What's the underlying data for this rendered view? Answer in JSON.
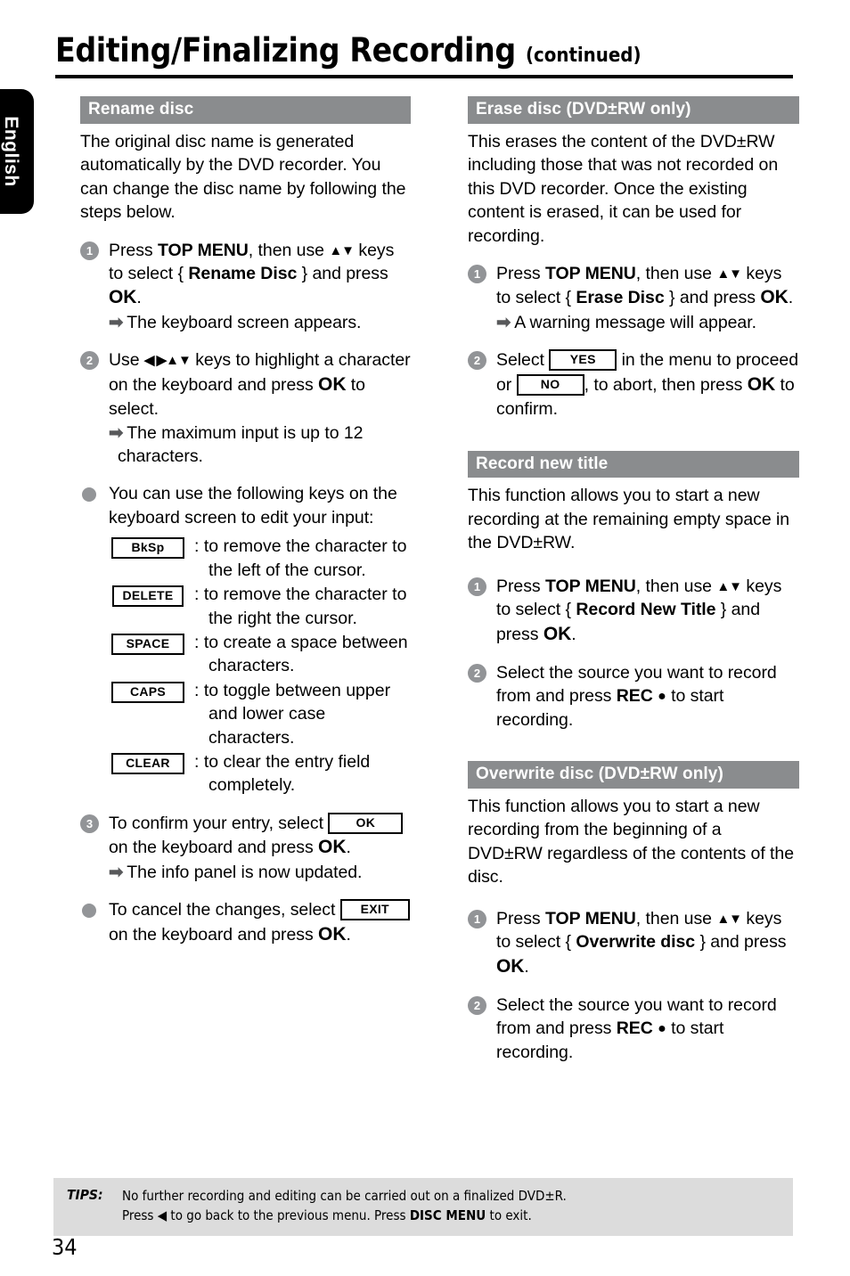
{
  "language_tab": "English",
  "header": {
    "title": "Editing/Finalizing Recording",
    "continued": "(continued)"
  },
  "left_column": {
    "section1": {
      "bar_title": "Rename disc",
      "intro": "The original disc name is generated automatically by the DVD recorder. You can change the disc name by following the steps below.",
      "step1": {
        "num": "1",
        "text_a": "Press ",
        "bold_a": "TOP MENU",
        "text_b": ", then use ",
        "keys": "▲▼",
        "text_c": " keys to select { ",
        "bold_b": "Rename Disc",
        "text_d": " } and press ",
        "bold_c": "OK",
        "text_e": ".",
        "sub": "The keyboard screen appears."
      },
      "step2": {
        "num": "2",
        "text_a": "Use ",
        "keys": "◀ ▶▲▼",
        "text_b": " keys to highlight a character on the keyboard and press ",
        "bold_a": "OK",
        "text_c": " to select.",
        "sub": "The maximum input is up to 12 characters."
      },
      "bullet1": "You can use the following keys on the keyboard screen to edit your input:",
      "keytable": [
        {
          "key": "BkSp",
          "desc": ": to remove the character to the left of the cursor."
        },
        {
          "key": "DELETE",
          "desc": ": to remove the character to the right the cursor."
        },
        {
          "key": "SPACE",
          "desc": ": to create a space between characters."
        },
        {
          "key": "CAPS",
          "desc": ": to toggle between upper and lower case characters."
        },
        {
          "key": "CLEAR",
          "desc": ": to clear the entry field completely."
        }
      ],
      "step3": {
        "num": "3",
        "text_a": "To confirm your entry, select ",
        "keycap": "OK",
        "text_b": " on the keyboard and press ",
        "bold_a": "OK",
        "text_c": ".",
        "sub": "The info panel is now updated."
      },
      "bullet2": {
        "text_a": "To cancel the changes, select ",
        "keycap": "EXIT",
        "text_b": " on the keyboard and press ",
        "bold_a": "OK",
        "text_c": "."
      }
    }
  },
  "right_column": {
    "section_erase": {
      "bar_title": "Erase disc (DVD±RW only)",
      "intro": "This erases the content of the DVD±RW including those that was not recorded on this DVD recorder. Once the existing content is erased, it can be used for recording.",
      "step1": {
        "num": "1",
        "text_a": "Press ",
        "bold_a": "TOP MENU",
        "text_b": ", then use ",
        "keys": "▲▼",
        "text_c": " keys to select { ",
        "bold_b": "Erase Disc",
        "text_d": " } and press ",
        "bold_c": "OK",
        "text_e": ".",
        "sub": "A warning message will appear."
      },
      "step2": {
        "num": "2",
        "text_a": "Select ",
        "keycap_yes": "YES",
        "text_b": " in the menu to proceed or ",
        "keycap_no": "NO",
        "text_c": ", to abort, then press ",
        "bold_a": "OK",
        "text_d": " to confirm."
      }
    },
    "section_record": {
      "bar_title": "Record new title",
      "intro": "This function allows you to start a new recording at the remaining empty space in the DVD±RW.",
      "step1": {
        "num": "1",
        "text_a": "Press ",
        "bold_a": "TOP MENU",
        "text_b": ", then use ",
        "keys": "▲▼",
        "text_c": " keys to select { ",
        "bold_b": "Record New Title",
        "text_d": " } and press ",
        "bold_c": "OK",
        "text_e": "."
      },
      "step2": {
        "num": "2",
        "text_a": "Select the source you want to record from and press ",
        "bold_a": "REC",
        "dot": "●",
        "text_b": " to start recording."
      }
    },
    "section_overwrite": {
      "bar_title": "Overwrite disc (DVD±RW only)",
      "intro": "This function allows you to start a new recording from the beginning of a DVD±RW regardless of the contents of the disc.",
      "step1": {
        "num": "1",
        "text_a": "Press ",
        "bold_a": "TOP MENU",
        "text_b": ", then use ",
        "keys": "▲▼",
        "text_c": " keys to select { ",
        "bold_b": "Overwrite disc",
        "text_d": " } and press ",
        "bold_c": "OK",
        "text_e": "."
      },
      "step2": {
        "num": "2",
        "text_a": "Select the source you want to record from and press ",
        "bold_a": "REC",
        "dot": "●",
        "text_b": " to start recording."
      }
    }
  },
  "tips": {
    "label": "TIPS:",
    "line1": "No further recording and editing can be carried out on a finalized DVD±R.",
    "line2_a": "Press ",
    "line2_arrow": "◀",
    "line2_b": " to go back to the previous menu. Press ",
    "line2_bold": "DISC MENU",
    "line2_c": " to exit."
  },
  "page_number": "34",
  "colors": {
    "section_bar": "#8a8c8e",
    "step_badge": "#929497",
    "tips_background": "#dcdcdc",
    "tab_background": "#000000"
  }
}
